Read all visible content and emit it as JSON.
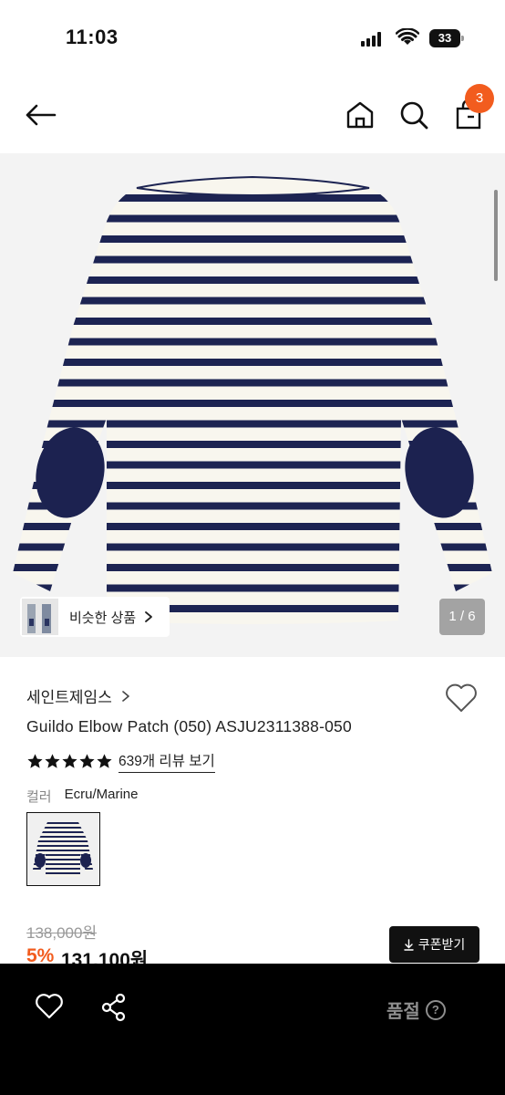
{
  "status_bar": {
    "time": "11:03",
    "battery": "33"
  },
  "header": {
    "cart_count": "3"
  },
  "gallery": {
    "similar_label": "비슷한 상품",
    "page_indicator": "1 / 6",
    "stripe_color": "#1d2452",
    "base_color": "#f8f6ee"
  },
  "product": {
    "brand": "세인트제임스",
    "title": "Guildo Elbow Patch (050) ASJU2311388-050",
    "rating_stars": 5,
    "review_link": "639개 리뷰 보기",
    "color_label": "컬러",
    "color_value": "Ecru/Marine",
    "original_price": "138,000원",
    "discount": "5%",
    "sale_price": "131,100원",
    "coupon_label": "쿠폰받기"
  },
  "bottom_bar": {
    "status": "품절",
    "help": "?"
  },
  "colors": {
    "accent": "#f25c1e",
    "dark": "#111111"
  }
}
